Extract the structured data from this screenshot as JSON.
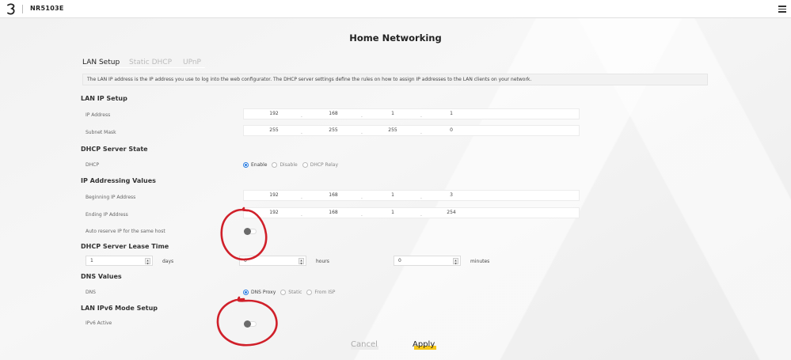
{
  "header": {
    "model": "NR5103E",
    "logo_icon": "three-logo-icon",
    "menu_icon": "hamburger-icon"
  },
  "page_title": "Home Networking",
  "tabs": [
    {
      "label": "LAN Setup",
      "active": true
    },
    {
      "label": "Static DHCP",
      "active": false
    },
    {
      "label": "UPnP",
      "active": false
    }
  ],
  "info_text": "The LAN IP address is the IP address you use to log into the web configurator. The DHCP server settings define the rules on how to assign IP addresses to the LAN clients on your network.",
  "lan_ip_setup": {
    "title": "LAN IP Setup",
    "ip_address": {
      "label": "IP Address",
      "octets": [
        "192",
        "168",
        "1",
        "1"
      ]
    },
    "subnet_mask": {
      "label": "Subnet Mask",
      "octets": [
        "255",
        "255",
        "255",
        "0"
      ]
    }
  },
  "dhcp_state": {
    "title": "DHCP Server State",
    "label": "DHCP",
    "options": [
      "Enable",
      "Disable",
      "DHCP Relay"
    ],
    "selected": "Enable"
  },
  "ip_addressing": {
    "title": "IP Addressing Values",
    "beginning": {
      "label": "Beginning IP Address",
      "octets": [
        "192",
        "168",
        "1",
        "3"
      ]
    },
    "ending": {
      "label": "Ending IP Address",
      "octets": [
        "192",
        "168",
        "1",
        "254"
      ]
    },
    "auto_reserve": {
      "label": "Auto reserve IP for the same host",
      "enabled": false
    }
  },
  "lease_time": {
    "title": "DHCP Server Lease Time",
    "days": {
      "value": "1",
      "unit": "days"
    },
    "hours": {
      "value": "0",
      "unit": "hours"
    },
    "minutes": {
      "value": "0",
      "unit": "minutes"
    }
  },
  "dns": {
    "title": "DNS Values",
    "label": "DNS",
    "options": [
      "DNS Proxy",
      "Static",
      "From ISP"
    ],
    "selected": "DNS Proxy"
  },
  "ipv6": {
    "title": "LAN IPv6 Mode Setup",
    "label": "IPv6 Active",
    "enabled": false
  },
  "buttons": {
    "cancel": "Cancel",
    "apply": "Apply"
  },
  "colors": {
    "accent_yellow": "#f7c718",
    "radio_blue": "#2b7de1",
    "annotation_red": "#d0202a"
  }
}
